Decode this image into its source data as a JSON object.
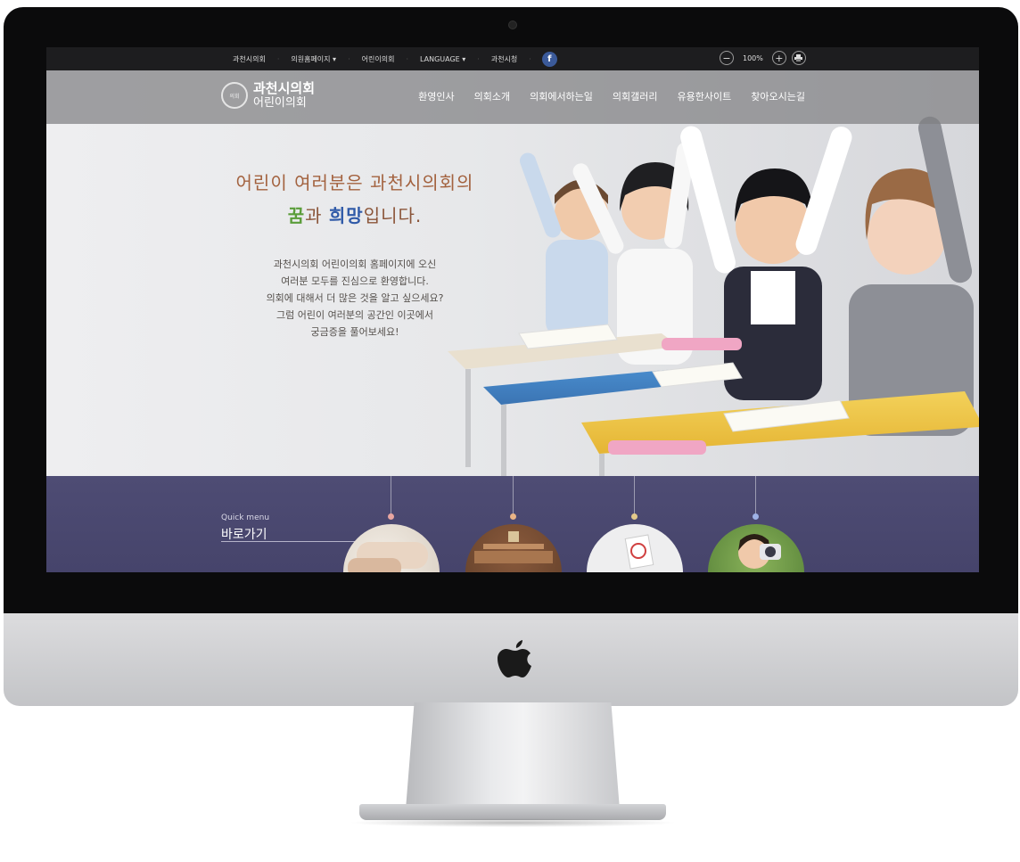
{
  "topbar": {
    "links": [
      "과천시의회",
      "의원홈페이지 ▾",
      "어린이의회",
      "LANGUAGE ▾",
      "과천시청"
    ],
    "facebook_label": "f",
    "zoom_out": "−",
    "zoom_value": "100%",
    "zoom_in": "+",
    "print_icon": "printer-icon"
  },
  "header": {
    "logo_title": "과천시의회",
    "logo_subtitle": "어린이의회",
    "seal_text": "의회",
    "nav": [
      "환영인사",
      "의회소개",
      "의회에서하는일",
      "의회갤러리",
      "유용한사이트",
      "찾아오시는길"
    ]
  },
  "hero": {
    "headline_line1": "어린이 여러분은 과천시의회의",
    "headline_dream": "꿈",
    "headline_and": "과 ",
    "headline_hope": "희망",
    "headline_end": "입니다.",
    "intro": [
      "과천시의회 어린이의회 홈페이지에 오신",
      "여러분 모두를 진심으로 환영합니다.",
      "의회에 대해서 더 많은 것을 알고 싶으세요?",
      "그럼 어린이 여러분의 공간인 이곳에서",
      "궁금증을 풀어보세요!"
    ]
  },
  "quick": {
    "label_en": "Quick menu",
    "label_ko": "바로가기",
    "dot_colors": [
      "#e8a6a1",
      "#e9b486",
      "#e3c98a",
      "#9eb2e6"
    ]
  },
  "colors": {
    "topbar": "#1d1d1f",
    "quick_bg": "#4e4c74",
    "headline": "#a3623f",
    "dream": "#5b9d3a",
    "hope": "#2f5aa8"
  }
}
